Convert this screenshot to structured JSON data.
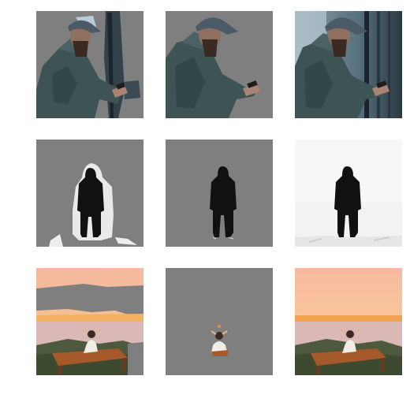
{
  "figure": {
    "rows": [
      {
        "subject": "man-with-phone",
        "panels": [
          {
            "kind": "masked",
            "matte": "coarse-gray"
          },
          {
            "kind": "masked",
            "matte": "tight-gray"
          },
          {
            "kind": "original",
            "matte": "none"
          }
        ]
      },
      {
        "subject": "standing-figure",
        "panels": [
          {
            "kind": "masked",
            "matte": "halo-white-on-gray"
          },
          {
            "kind": "masked",
            "matte": "tight-gray"
          },
          {
            "kind": "original",
            "matte": "none"
          }
        ]
      },
      {
        "subject": "person-on-table-sunset",
        "panels": [
          {
            "kind": "masked",
            "matte": "partial-sky-gray"
          },
          {
            "kind": "masked",
            "matte": "subject-only-gray"
          },
          {
            "kind": "original",
            "matte": "none"
          }
        ]
      }
    ],
    "colors": {
      "mask_gray": "#7f7f7f",
      "jacket": "#3d5354",
      "cap": "#4a5a66",
      "figure_black": "#111111",
      "snow": "#f2f2f2",
      "sunset_top": "#f7b9a1",
      "sunset_horizon": "#f5a36a",
      "mist": "#d9b8b6",
      "table_wood": "#a65a2c"
    }
  }
}
